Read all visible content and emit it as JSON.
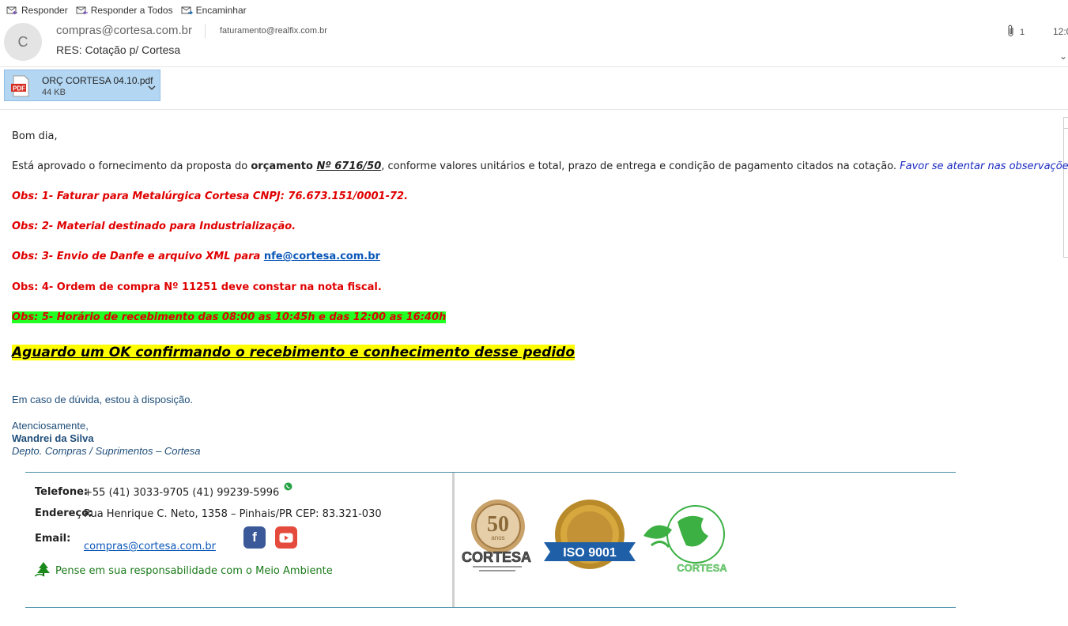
{
  "toolbar": {
    "reply": "Responder",
    "reply_all": "Responder a Todos",
    "forward": "Encaminhar"
  },
  "header": {
    "avatar_initial": "C",
    "from": "compras@cortesa.com.br",
    "to": "faturamento@realfix.com.br",
    "subject": "RES: Cotação p/ Cortesa",
    "attachment_count": "1",
    "time": "12:0"
  },
  "attachment": {
    "icon_label": "PDF",
    "name": "ORÇ CORTESA 04.10.pdf",
    "size": "44 KB"
  },
  "body": {
    "greeting": "Bom dia,",
    "approval_pre": "Está aprovado o fornecimento da proposta do ",
    "approval_bold": "orçamento ",
    "approval_num": "Nº 6716/50",
    "approval_post": ", conforme valores unitários e total, prazo de entrega e condição de pagamento citados na cotação. ",
    "approval_note": "Favor se atentar nas observações abaixo:",
    "obs1": "Obs: 1- Faturar para Metalúrgica Cortesa CNPJ: 76.673.151/0001-72.",
    "obs2": "Obs: 2- Material destinado para Industrialização.",
    "obs3_pre": "Obs: 3- Envio de Danfe e arquivo XML para ",
    "obs3_link": "nfe@cortesa.com.br",
    "obs4": "Obs: 4- Ordem de compra Nº  11251  deve constar na nota fiscal.",
    "obs5": "Obs: 5- Horário de recebimento das 08:00 as 10:45h e das 12:00 as 16:40h",
    "aguardo": "Aguardo um OK confirmando o recebimento e conhecimento desse pedido",
    "duvida": "Em caso de dúvida, estou à disposição.",
    "closing": "Atenciosamente,",
    "name": "Wandrei da Silva",
    "dept": "Depto. Compras / Suprimentos – Cortesa"
  },
  "signature": {
    "phone_label": "Telefone:",
    "phone_value": "+55 (41) 3033-9705  (41) 99239-5996",
    "address_label": "Endereço:",
    "address_value": "Rua Henrique C. Neto, 1358 – Pinhais/PR CEP: 83.321-030",
    "email_label": "Email:",
    "email_value": "compras@cortesa.com.br",
    "environment": "Pense em sua responsabilidade com o Meio Ambiente",
    "logo_50_number": "50",
    "logo_50_anos": "anos",
    "logo_brand": "CORTESA",
    "iso_text": "ISO 9001",
    "eco_brand": "CORTESA"
  },
  "colors": {
    "attachment_bg": "#b3d6f2",
    "red_obs": "#e00000",
    "highlight_green": "#22ff22",
    "highlight_yellow": "#ffff00",
    "signature_blue": "#1f4e79",
    "facebook": "#3b5998",
    "youtube": "#e54b3c"
  }
}
